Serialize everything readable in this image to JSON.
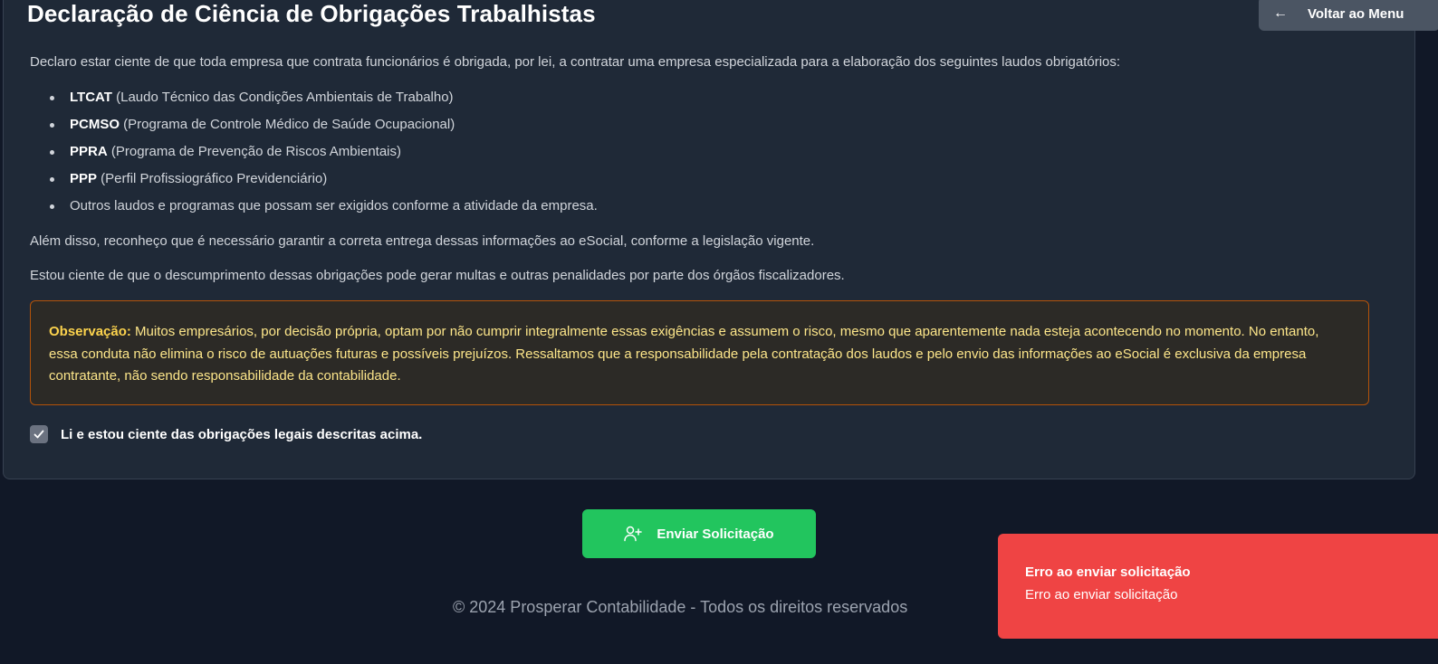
{
  "header": {
    "title": "Declaração de Ciência de Obrigações Trabalhistas",
    "back_label": "Voltar ao Menu"
  },
  "intro": "Declaro estar ciente de que toda empresa que contrata funcionários é obrigada, por lei, a contratar uma empresa especializada para a elaboração dos seguintes laudos obrigatórios:",
  "reports": [
    {
      "code": "LTCAT",
      "desc": " (Laudo Técnico das Condições Ambientais de Trabalho)"
    },
    {
      "code": "PCMSO",
      "desc": " (Programa de Controle Médico de Saúde Ocupacional)"
    },
    {
      "code": "PPRA",
      "desc": " (Programa de Prevenção de Riscos Ambientais)"
    },
    {
      "code": "PPP",
      "desc": " (Perfil Profissiográfico Previdenciário)"
    },
    {
      "code": "",
      "desc": "Outros laudos e programas que possam ser exigidos conforme a atividade da empresa."
    }
  ],
  "para_esocial": "Além disso, reconheço que é necessário garantir a correta entrega dessas informações ao eSocial, conforme a legislação vigente.",
  "para_penalties": "Estou ciente de que o descumprimento dessas obrigações pode gerar multas e outras penalidades por parte dos órgãos fiscalizadores.",
  "notice": {
    "label": "Observação:",
    "text": " Muitos empresários, por decisão própria, optam por não cumprir integralmente essas exigências e assumem o risco, mesmo que aparentemente nada esteja acontecendo no momento. No entanto, essa conduta não elimina o risco de autuações futuras e possíveis prejuízos. Ressaltamos que a responsabilidade pela contratação dos laudos e pelo envio das informações ao eSocial é exclusiva da empresa contratante, não sendo responsabilidade da contabilidade."
  },
  "checkbox": {
    "label": "Li e estou ciente das obrigações legais descritas acima.",
    "checked": true
  },
  "submit_label": "Enviar Solicitação",
  "footer": "© 2024 Prosperar Contabilidade - Todos os direitos reservados",
  "toast": {
    "title": "Erro ao enviar solicitação",
    "description": "Erro ao enviar solicitação"
  },
  "colors": {
    "background": "#111827",
    "card": "#1f2937",
    "success": "#22c55e",
    "error": "#ef4444",
    "warning_border": "#b45309"
  }
}
